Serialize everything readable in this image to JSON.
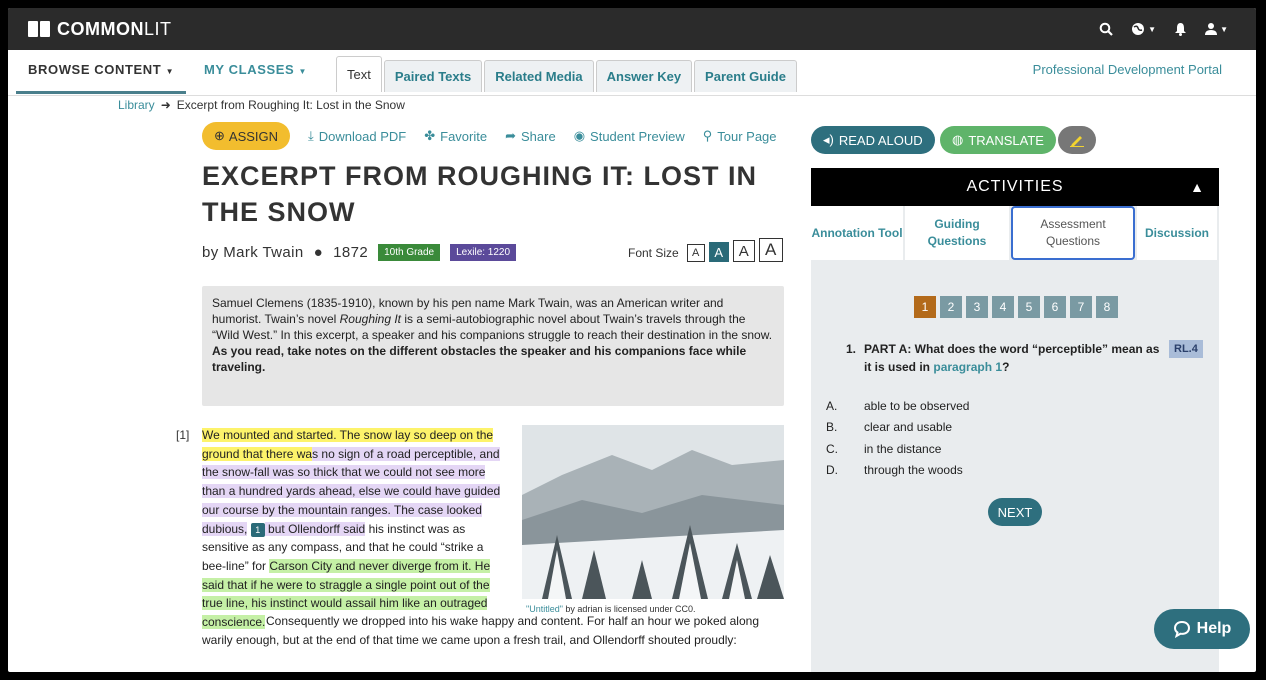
{
  "brand": {
    "bold": "COMMON",
    "light": "LIT"
  },
  "nav": {
    "browse": "BROWSE CONTENT",
    "classes": "MY CLASSES",
    "tabs": [
      "Text",
      "Paired Texts",
      "Related Media",
      "Answer Key",
      "Parent Guide"
    ],
    "active_tab": "Text",
    "portal": "Professional Development Portal"
  },
  "breadcrumb": {
    "library": "Library",
    "current": "Excerpt from Roughing It: Lost in the Snow"
  },
  "actions": {
    "assign": "ASSIGN",
    "download": "Download PDF",
    "favorite": "Favorite",
    "share": "Share",
    "preview": "Student Preview",
    "tour": "Tour Page"
  },
  "text": {
    "title": "EXCERPT FROM ROUGHING IT: LOST IN THE SNOW",
    "author": "by Mark Twain",
    "year": "1872",
    "grade": "10th Grade",
    "lexile": "Lexile: 1220",
    "font_size_label": "Font Size",
    "font_sizes": [
      "A",
      "A",
      "A",
      "A"
    ],
    "intro_p1a": "Samuel Clemens (1835-1910), known by his pen name Mark Twain, was an American writer and humorist. Twain’s novel ",
    "intro_italic": "Roughing It",
    "intro_p1b": " is a semi-autobiographic novel about Twain’s travels through the “Wild West.” In this excerpt, a speaker and his companions struggle to reach their destination in the snow.",
    "intro_bold": "As you read, take notes on the different obstacles the speaker and his companions face while traveling.",
    "para_num": "[1]",
    "p_hl_yellow": "We mounted and started. The snow lay so deep on the ground that there wa",
    "p_hl_purple": "s no sign of a road perceptible, and the snow-fall was so thick that we could not see more than a hundred yards ahead, else we could have guided our course by the mountain ranges. The case looked dubious,",
    "p_marker": "1",
    "p_purple_2": " but Ollendorff said",
    "p_plain_1": " his instinct was as sensitive as any compass, and that he could “strike a bee-line” for ",
    "p_hl_green": "Carson City and never diverge from it. He said that if he were to straggle a single point out of the true line, his instinct would assail him like an outraged conscience.",
    "p_plain_2": " Consequently we dropped into his wake happy and content. For half an hour we poked along warily enough, but at the end of that time we came upon a fresh trail, and Ollendorff shouted proudly:",
    "caption_link": "\"Untitled\"",
    "caption_rest": " by adrian is licensed under CC0."
  },
  "panel": {
    "read_aloud": "READ ALOUD",
    "translate": "TRANSLATE",
    "activities": "ACTIVITIES",
    "tabs": [
      "Annotation Tool",
      "Guiding Questions",
      "Assessment Questions",
      "Discussion"
    ],
    "pages": [
      "1",
      "2",
      "3",
      "4",
      "5",
      "6",
      "7",
      "8"
    ],
    "current_page": 1,
    "q_num": "1.",
    "q_text_a": "PART A: What does the word “perceptible” mean as it is used in ",
    "q_link": "paragraph 1",
    "q_text_b": "?",
    "standard": "RL.4",
    "options": [
      {
        "letter": "A.",
        "text": "able to be observed"
      },
      {
        "letter": "B.",
        "text": "clear and usable"
      },
      {
        "letter": "C.",
        "text": "in the distance"
      },
      {
        "letter": "D.",
        "text": "through the woods"
      }
    ],
    "next": "NEXT"
  },
  "help": "Help",
  "colors": {
    "teal": "#2e6f7e",
    "link": "#3a8d9a",
    "assign": "#f2bd2e",
    "current_page": "#b36a1a"
  }
}
